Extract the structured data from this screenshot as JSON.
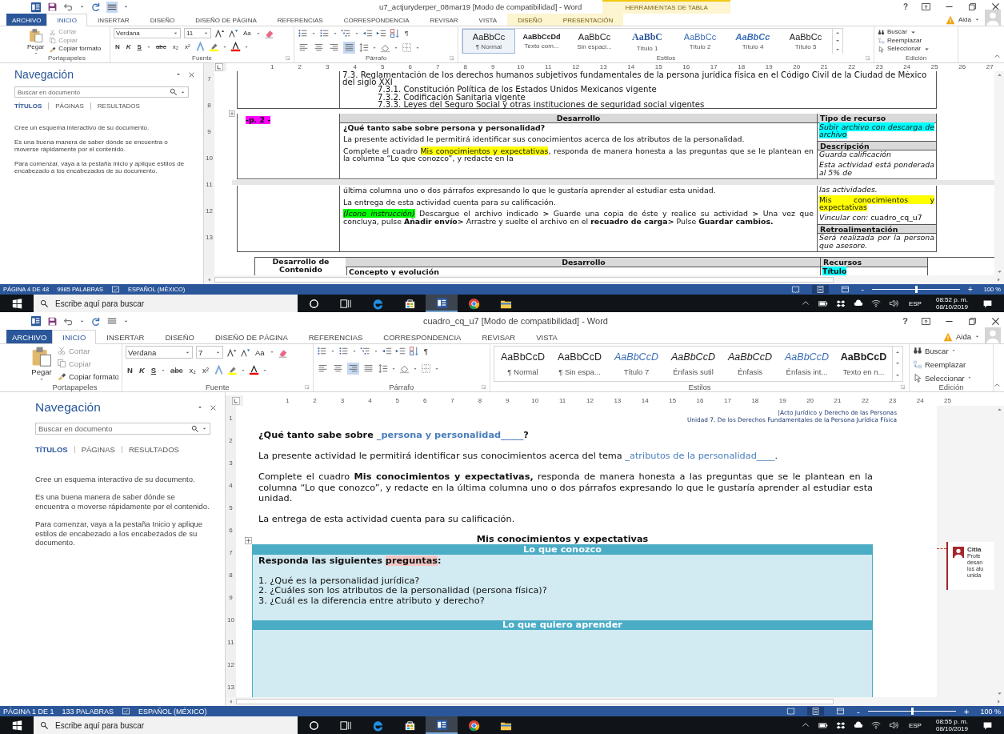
{
  "windows": [
    {
      "title": "u7_actjuryderper_08mar19 [Modo de compatibilidad] - Word",
      "help": "?",
      "contextual_group": "HERRAMIENTAS DE TABLA",
      "user": "Aida",
      "tabs": [
        {
          "label": "ARCHIVO",
          "kind": "file",
          "selected": false
        },
        {
          "label": "INICIO",
          "kind": "normal",
          "selected": true
        },
        {
          "label": "INSERTAR",
          "kind": "normal",
          "selected": false
        },
        {
          "label": "DISEÑO",
          "kind": "normal",
          "selected": false
        },
        {
          "label": "DISEÑO DE PÁGINA",
          "kind": "normal",
          "selected": false
        },
        {
          "label": "REFERENCIAS",
          "kind": "normal",
          "selected": false
        },
        {
          "label": "CORRESPONDENCIA",
          "kind": "normal",
          "selected": false
        },
        {
          "label": "REVISAR",
          "kind": "normal",
          "selected": false
        },
        {
          "label": "VISTA",
          "kind": "normal",
          "selected": false
        },
        {
          "label": "DISEÑO",
          "kind": "contextual",
          "selected": false
        },
        {
          "label": "PRESENTACIÓN",
          "kind": "contextual",
          "selected": false
        }
      ],
      "ribbon": {
        "clipboard": {
          "paste": "Pegar",
          "cut": "Cortar",
          "copy": "Copiar",
          "format_painter": "Copiar formato",
          "label": "Portapapeles"
        },
        "font": {
          "name": "Verdana",
          "size": "11",
          "change_case": "Aa",
          "bold": "N",
          "italic": "K",
          "underline": "S",
          "strikethrough": "abc",
          "subscript": "x₂",
          "superscript": "x²",
          "label": "Fuente"
        },
        "paragraph": {
          "align_buttons": [
            {
              "selected": false
            },
            {
              "selected": false
            },
            {
              "selected": false
            },
            {
              "selected": true
            }
          ],
          "marks": "¶",
          "label": "Párrafo"
        },
        "styles": {
          "label": "Estilos",
          "items": [
            {
              "preview": "AaBbCc",
              "name": "¶ Normal",
              "kind": "plain",
              "selected": true
            },
            {
              "preview": "AaBbCcDd",
              "name": "Texto com...",
              "kind": "small-bold",
              "selected": false
            },
            {
              "preview": "AaBbCc",
              "name": "Sin espaci...",
              "kind": "plain",
              "selected": false
            },
            {
              "preview": "AaBbC",
              "name": "Título 1",
              "kind": "heading",
              "selected": false
            },
            {
              "preview": "AaBbCc",
              "name": "Título 2",
              "kind": "blue",
              "selected": false
            },
            {
              "preview": "AaBbCc",
              "name": "Título 4",
              "kind": "blue-bold-italic",
              "selected": false
            },
            {
              "preview": "AaBbCc",
              "name": "Título 5",
              "kind": "plain",
              "selected": false
            }
          ]
        },
        "editing": {
          "find": "Buscar",
          "replace": "Reemplazar",
          "select": "Seleccionar",
          "label": "Edición"
        }
      },
      "navigation": {
        "title": "Navegación",
        "search_placeholder": "Buscar en documento",
        "tabs": [
          {
            "label": "TÍTULOS",
            "selected": true
          },
          {
            "label": "PÁGINAS",
            "selected": false
          },
          {
            "label": "RESULTADOS",
            "selected": false
          }
        ],
        "paragraphs": [
          "Cree un esquema interactivo de su documento.",
          "Es una buena manera de saber dónde se encuentra o moverse rápidamente por el contenido.",
          "Para comenzar, vaya a la pestaña Inicio y aplique estilos de encabezado a los encabezados de su documento."
        ]
      },
      "ruler": [
        "1",
        "2",
        "3",
        "4",
        "5",
        "6",
        "7",
        "8",
        "9",
        "10",
        "11",
        "12",
        "13",
        "14",
        "15",
        "16",
        "17",
        "18",
        "19",
        "20",
        "21",
        "22",
        "23",
        "24",
        "25",
        "26",
        "27"
      ],
      "vertical_ruler": [
        "7",
        "8",
        "9",
        "10",
        "11",
        "12",
        "13"
      ],
      "document": {
        "blocks": [
          {
            "kind": "outline",
            "items": [
              {
                "text": "7.3. Reglamentación de los derechos humanos subjetivos fundamentales de la persona jurídica física en el Código Civil de la Ciudad de México del siglo XXI",
                "children": [
                  {
                    "text": "7.3.1. Constitución Política de los Estados Unidos Mexicanos vigente"
                  },
                  {
                    "text": "7.3.2. Codificación Sanitaria vigente"
                  },
                  {
                    "text": "7.3.3. Leyes del Seguro Social y otras instituciones de seguridad social vigentes"
                  }
                ]
              }
            ]
          },
          {
            "kind": "activity",
            "label": {
              "text": "-p. 2 -",
              "color": "#ff00ff"
            },
            "headers": [
              "Desarrollo",
              "Tipo de recurso"
            ],
            "segments": [
              {
                "main": [
                  {
                    "runs": [
                      {
                        "text": "¿Qué tanto sabe sobre persona y personalidad?",
                        "bold": true
                      }
                    ]
                  },
                  {
                    "runs": [
                      {
                        "text": "La presente actividad le permitirá identificar sus conocimientos acerca de los atributos de la personalidad."
                      }
                    ]
                  },
                  {
                    "runs": [
                      {
                        "text": "Complete el cuadro "
                      },
                      {
                        "text": "Mis conocimientos y expectativas",
                        "color": "#ffff00"
                      },
                      {
                        "text": ", responda de manera honesta a las preguntas que se le plantean en la columna “Lo que conozco”, y redacte en la"
                      }
                    ]
                  }
                ],
                "side": [
                  {
                    "kind": "text",
                    "runs": [
                      {
                        "text": "Subir archivo con descarga de archivo",
                        "italic": true,
                        "color": "#00ffff"
                      }
                    ]
                  },
                  {
                    "kind": "header",
                    "text": "Descripción"
                  },
                  {
                    "kind": "text",
                    "runs": [
                      {
                        "text": "Guarda calificación",
                        "italic": true
                      }
                    ]
                  },
                  {
                    "kind": "text",
                    "runs": [
                      {
                        "text": "Esta actividad está ponderada al 5% de",
                        "italic": true
                      }
                    ]
                  }
                ]
              },
              {
                "main": [
                  {
                    "runs": [
                      {
                        "text": "última columna uno o dos párrafos expresando lo que le gustaría aprender al estudiar esta unidad."
                      }
                    ]
                  },
                  {
                    "runs": [
                      {
                        "text": "La entrega de esta actividad cuenta para su calificación."
                      }
                    ]
                  },
                  {
                    "runs": [
                      {
                        "text": "(Ícono instrucción)",
                        "italic": true,
                        "color": "#00ff00"
                      },
                      {
                        "text": " Descargue el archivo indicado "
                      },
                      {
                        "text": ">",
                        "bold": true
                      },
                      {
                        "text": " Guarde una copia de éste y realice su actividad "
                      },
                      {
                        "text": ">",
                        "bold": true
                      },
                      {
                        "text": " Una vez que concluya, pulse "
                      },
                      {
                        "text": "Añadir envío>",
                        "bold": true
                      },
                      {
                        "text": " Arrastre y suelte el archivo en el "
                      },
                      {
                        "text": "recuadro de carga>",
                        "bold": true
                      },
                      {
                        "text": " Pulse "
                      },
                      {
                        "text": "Guardar cambios.",
                        "bold": true
                      }
                    ]
                  }
                ],
                "side": [
                  {
                    "kind": "text",
                    "runs": [
                      {
                        "text": "las actividades.",
                        "italic": true
                      }
                    ]
                  },
                  {
                    "kind": "text",
                    "runs": [
                      {
                        "text": "Mis conocimientos y expectativas",
                        "color": "#ffff00"
                      }
                    ]
                  },
                  {
                    "kind": "text",
                    "runs": [
                      {
                        "text": "Vincular con:",
                        "italic": true
                      },
                      {
                        "text": " cuadro_cq_u7"
                      }
                    ]
                  },
                  {
                    "kind": "header",
                    "text": "Retroalimentación"
                  },
                  {
                    "kind": "text",
                    "runs": [
                      {
                        "text": "Será realizada por la persona que asesore.",
                        "italic": true
                      }
                    ]
                  }
                ]
              }
            ]
          },
          {
            "kind": "content_table",
            "row_label": "Desarrollo de Contenido",
            "headers": [
              "Desarrollo",
              "Recursos"
            ],
            "cells": [
              {
                "runs": [
                  {
                    "text": "Concepto y evolución",
                    "bold": true
                  }
                ]
              },
              {
                "runs": [
                  {
                    "text": "Título",
                    "bold": true,
                    "color": "#00ffff"
                  }
                ]
              }
            ]
          }
        ]
      },
      "status_bar": {
        "page": "PÁGINA 4 DE 48",
        "words": "9985 PALABRAS",
        "language": "ESPAÑOL (MÉXICO)",
        "views": [
          {
            "selected": false
          },
          {
            "selected": true
          },
          {
            "selected": false
          }
        ],
        "zoom_out": "-",
        "zoom_in": "+",
        "level": 0.5,
        "zoom": "100 %"
      },
      "taskbar": {
        "search_placeholder": "Escribe aquí para buscar",
        "apps": [
          {
            "kind": "cortana",
            "active": false
          },
          {
            "kind": "taskview",
            "active": false
          },
          {
            "kind": "edge",
            "active": false
          },
          {
            "kind": "store",
            "active": false
          },
          {
            "kind": "word",
            "active": true
          },
          {
            "kind": "chrome",
            "active": false
          },
          {
            "kind": "explorer",
            "active": false
          }
        ],
        "language": "ESP",
        "time": "08:52 p. m.",
        "date": "08/10/2019"
      }
    },
    {
      "title": "cuadro_cq_u7 [Modo de compatibilidad] - Word",
      "help": "?",
      "user": "Aida",
      "tabs": [
        {
          "label": "ARCHIVO",
          "kind": "file",
          "selected": false
        },
        {
          "label": "INICIO",
          "kind": "normal",
          "selected": true
        },
        {
          "label": "INSERTAR",
          "kind": "normal",
          "selected": false
        },
        {
          "label": "DISEÑO",
          "kind": "normal",
          "selected": false
        },
        {
          "label": "DISEÑO DE PÁGINA",
          "kind": "normal",
          "selected": false
        },
        {
          "label": "REFERENCIAS",
          "kind": "normal",
          "selected": false
        },
        {
          "label": "CORRESPONDENCIA",
          "kind": "normal",
          "selected": false
        },
        {
          "label": "REVISAR",
          "kind": "normal",
          "selected": false
        },
        {
          "label": "VISTA",
          "kind": "normal",
          "selected": false
        }
      ],
      "ribbon": {
        "clipboard": {
          "paste": "Pegar",
          "cut": "Cortar",
          "copy": "Copiar",
          "format_painter": "Copiar formato",
          "label": "Portapapeles"
        },
        "font": {
          "name": "Verdana",
          "size": "7",
          "change_case": "Aa",
          "bold": "N",
          "italic": "K",
          "underline": "S",
          "strikethrough": "abc",
          "subscript": "x₂",
          "superscript": "x²",
          "label": "Fuente"
        },
        "paragraph": {
          "align_buttons": [
            {
              "selected": false
            },
            {
              "selected": false
            },
            {
              "selected": true
            },
            {
              "selected": false
            }
          ],
          "marks": "¶",
          "label": "Párrafo"
        },
        "styles": {
          "label": "Estilos",
          "items": [
            {
              "preview": "AaBbCcD",
              "name": "¶ Normal",
              "kind": "plain",
              "selected": false
            },
            {
              "preview": "AaBbCcD",
              "name": "¶ Sin espa...",
              "kind": "plain",
              "selected": false
            },
            {
              "preview": "AaBbCcD",
              "name": "Título 7",
              "kind": "blue-italic",
              "selected": false
            },
            {
              "preview": "AaBbCcD",
              "name": "Énfasis sutil",
              "kind": "italic",
              "selected": false
            },
            {
              "preview": "AaBbCcD",
              "name": "Énfasis",
              "kind": "italic",
              "selected": false
            },
            {
              "preview": "AaBbCcD",
              "name": "Énfasis int...",
              "kind": "blue-italic",
              "selected": false
            },
            {
              "preview": "AaBbCcD",
              "name": "Texto en n...",
              "kind": "bold",
              "selected": false
            }
          ]
        },
        "editing": {
          "find": "Buscar",
          "replace": "Reemplazar",
          "select": "Seleccionar",
          "label": "Edición"
        }
      },
      "navigation": {
        "title": "Navegación",
        "search_placeholder": "Buscar en documento",
        "tabs": [
          {
            "label": "TÍTULOS",
            "selected": true
          },
          {
            "label": "PÁGINAS",
            "selected": false
          },
          {
            "label": "RESULTADOS",
            "selected": false
          }
        ],
        "paragraphs": [
          "Cree un esquema interactivo de su documento.",
          "Es una buena manera de saber dónde se encuentra o moverse rápidamente por el contenido.",
          "Para comenzar, vaya a la pestaña Inicio y aplique estilos de encabezado a los encabezados de su documento."
        ]
      },
      "ruler": [
        "1",
        "2",
        "3",
        "4",
        "5",
        "6",
        "7",
        "8",
        "9",
        "10",
        "11",
        "12",
        "13",
        "14",
        "15",
        "16",
        "17",
        "18",
        "19",
        "20",
        "21",
        "22",
        "23",
        "24",
        "25"
      ],
      "vertical_ruler": [
        "1",
        "2",
        "3",
        "4",
        "5",
        "6",
        "7",
        "8",
        "9",
        "10",
        "11",
        "12",
        "13"
      ],
      "document": {
        "blocks": [
          {
            "kind": "page_header",
            "lines": [
              "|Acto Jurídico y Derecho de las Personas",
              "Unidad 7. De los Derechos Fundamentales de la Persona Jurídica Física"
            ]
          },
          {
            "kind": "paragraph",
            "runs": [
              {
                "text": "¿Qué tanto sabe sobre ",
                "bold": true
              },
              {
                "text": "_persona y personalidad_____",
                "bold": true,
                "kind": "fill-in"
              },
              {
                "text": "?",
                "bold": true
              }
            ]
          },
          {
            "kind": "paragraph",
            "runs": [
              {
                "text": "La presente actividad le permitirá identificar sus conocimientos acerca del tema "
              },
              {
                "text": "_atributos de la personalidad____",
                "kind": "fill-in"
              },
              {
                "text": "."
              }
            ]
          },
          {
            "kind": "paragraph",
            "runs": [
              {
                "text": "Complete el cuadro "
              },
              {
                "text": "Mis conocimientos y expectativas,",
                "bold": true
              },
              {
                "text": " responda de manera honesta a las preguntas que se le plantean en la columna “Lo que conozco”, y redacte en la última columna uno o dos párrafos expresando lo que le gustaría aprender al estudiar esta unidad."
              }
            ]
          },
          {
            "kind": "paragraph",
            "runs": [
              {
                "text": "La entrega de esta actividad cuenta para su calificación."
              }
            ]
          },
          {
            "kind": "knowledge_table",
            "title": "Mis conocimientos y expectativas",
            "sections": [
              {
                "header": "Lo que conozco",
                "lines": [
                  {
                    "runs": [
                      {
                        "text": "Responda las siguientes ",
                        "bold": true
                      },
                      {
                        "text": "preguntas",
                        "bold": true,
                        "kind": "comment"
                      },
                      {
                        "text": ":",
                        "bold": true
                      }
                    ]
                  },
                  {
                    "runs": [
                      {
                        "text": "1. ¿Qué es la personalidad jurídica?"
                      }
                    ]
                  },
                  {
                    "runs": [
                      {
                        "text": "2. ¿Cuáles son los atributos de la personalidad (persona física)?"
                      }
                    ]
                  },
                  {
                    "runs": [
                      {
                        "text": "3. ¿Cuál es la diferencia entre atributo y derecho?"
                      }
                    ]
                  }
                ]
              },
              {
                "header": "Lo que quiero aprender"
              }
            ]
          }
        ],
        "comment": {
          "author": "Citla",
          "lines": [
            "Profe",
            "desan",
            "los alu",
            "unida"
          ]
        }
      },
      "status_bar": {
        "page": "PÁGINA 1 DE 1",
        "words": "133 PALABRAS",
        "language": "ESPAÑOL (MÉXICO)",
        "views": [
          {
            "selected": false
          },
          {
            "selected": true
          },
          {
            "selected": false
          }
        ],
        "zoom_out": "-",
        "zoom_in": "+",
        "level": 0.5,
        "zoom": "100 %"
      },
      "taskbar": {
        "search_placeholder": "Escribe aquí para buscar",
        "apps": [
          {
            "kind": "cortana",
            "active": false
          },
          {
            "kind": "taskview",
            "active": false
          },
          {
            "kind": "edge",
            "active": false
          },
          {
            "kind": "store",
            "active": false
          },
          {
            "kind": "word",
            "active": true
          },
          {
            "kind": "chrome",
            "active": false
          },
          {
            "kind": "explorer",
            "active": false
          }
        ],
        "language": "ESP",
        "time": "08:55 p. m.",
        "date": "08/10/2019"
      }
    }
  ]
}
